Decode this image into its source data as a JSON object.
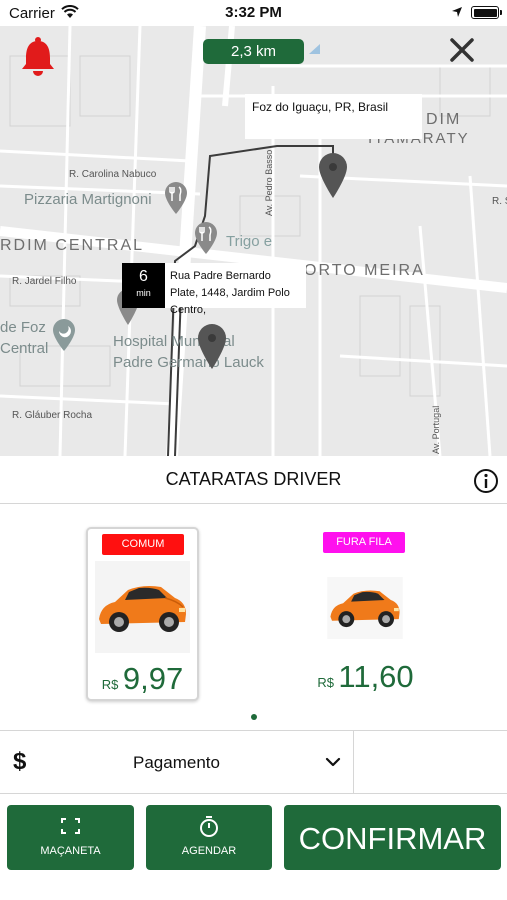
{
  "status_bar": {
    "carrier": "Carrier",
    "time": "3:32 PM"
  },
  "map": {
    "distance": "2,3 km",
    "destination": "Foz do Iguaçu, PR, Brasil",
    "eta_value": "6",
    "eta_unit": "min",
    "origin_address": "Rua Padre Bernardo Plate, 1448, Jardim Polo Centro,",
    "labels": {
      "r_carolina_nabuco": "R. Carolina Nabuco",
      "pizzaria": "Pizzaria Martignoni",
      "jardim_central": "RDIM CENTRAL",
      "trigo": "Trigo e",
      "r_jardel_filho": "R. Jardel Filho",
      "porto_meira": "ORTO MEIRA",
      "de_foz": "de Foz",
      "central": "Central",
      "hospital_1": "Hospital Municipal",
      "hospital_2": "Padre Germano Lauck",
      "r_glauber_rocha": "R. Gláuber Rocha",
      "dim": "DIM",
      "itamaraty": "ITAMARATY",
      "av_pedro_basso": "Av. Pedro Basso",
      "av_portugal": "Av. Portugal",
      "r_s": "R. S"
    }
  },
  "service": {
    "title": "CATARATAS DRIVER"
  },
  "categories": [
    {
      "label": "COMUM",
      "currency": "R$",
      "price": "9,97",
      "badge_color": "#ff1010"
    },
    {
      "label": "FURA FILA",
      "currency": "R$",
      "price": "11,60",
      "badge_color": "#ff10ee"
    }
  ],
  "payment": {
    "label": "Pagamento"
  },
  "buttons": {
    "macaneta": "MAÇANETA",
    "agendar": "AGENDAR",
    "confirmar": "CONFIRMAR"
  },
  "colors": {
    "primary": "#1f6a3a",
    "alert": "#e11b1b"
  }
}
